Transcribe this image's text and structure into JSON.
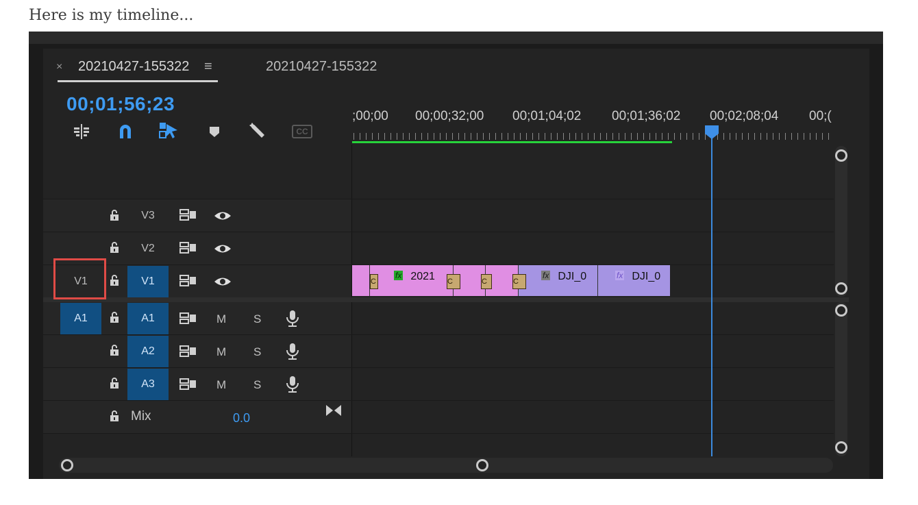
{
  "caption": "Here is my timeline...",
  "tabs": [
    {
      "label": "20210427-155322",
      "active": true
    },
    {
      "label": "20210427-155322",
      "active": false
    }
  ],
  "tab_close": "×",
  "tab_menu": "≡",
  "timecode": "00;01;56;23",
  "tools": [
    {
      "name": "insert-sequence-icon"
    },
    {
      "name": "snap-icon"
    },
    {
      "name": "linked-selection-icon"
    },
    {
      "name": "add-marker-icon"
    },
    {
      "name": "wrench-icon"
    },
    {
      "name": "captions-icon",
      "label": "CC"
    }
  ],
  "ruler": [
    ";00;00",
    "00;00;32;00",
    "00;01;04;02",
    "00;01;36;02",
    "00;02;08;04",
    "00;("
  ],
  "video_tracks": [
    {
      "name": "V3",
      "source": "",
      "targeted": false
    },
    {
      "name": "V2",
      "source": "",
      "targeted": false
    },
    {
      "name": "V1",
      "source": "V1",
      "targeted": true
    }
  ],
  "audio_tracks": [
    {
      "name": "A1",
      "source": "A1",
      "targeted": true,
      "m": "M",
      "s": "S"
    },
    {
      "name": "A2",
      "source": "",
      "targeted": true,
      "m": "M",
      "s": "S"
    },
    {
      "name": "A3",
      "source": "",
      "targeted": true,
      "m": "M",
      "s": "S"
    }
  ],
  "mix": {
    "label": "Mix",
    "value": "0.0"
  },
  "clips": [
    {
      "label": "2021",
      "fx": "fx"
    },
    {
      "label": "DJI_0",
      "fx": "fx"
    },
    {
      "label": "DJI_0",
      "fx": "fx"
    }
  ],
  "small_clip_letter": "C",
  "colors": {
    "accent": "#3e9bf2",
    "track_target": "#114f82",
    "work_area": "#27d33b",
    "clip_pink": "#e08ee3",
    "clip_violet": "#a594e3",
    "highlight": "#e04b46"
  }
}
